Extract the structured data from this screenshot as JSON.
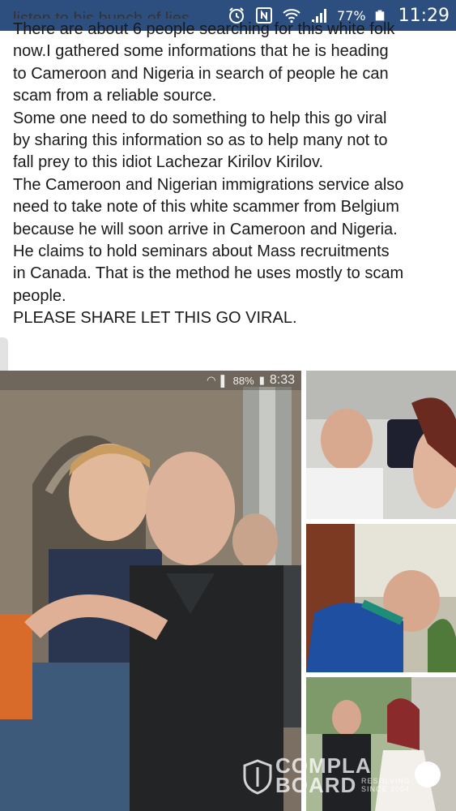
{
  "status_bar": {
    "battery": "77%",
    "time": "11:29",
    "icons": [
      "alarm-icon",
      "nfc-icon",
      "wifi-icon",
      "signal-icon",
      "battery-icon"
    ]
  },
  "post": {
    "cut_line": "listen to his bunch of lies.",
    "lines": [
      "There are about 6 people searching for this white folk",
      "now.I gathered some informations that he is heading",
      "to Cameroon and Nigeria in search of people he can",
      "scam from a reliable source.",
      "Some one need to do something to help this go viral",
      "by sharing this information so as to help many not to",
      "fall prey to this idiot Lachezar Kirilov Kirilov.",
      "The Cameroon and Nigerian immigrations service also",
      "need to take note of this white scammer from Belgium",
      "because he will soon arrive in Cameroon and Nigeria.",
      "He claims to hold seminars about Mass recruitments",
      "in Canada. That is the method he uses mostly to scam",
      "people.",
      "PLEASE SHARE LET THIS GO VIRAL."
    ]
  },
  "main_photo": {
    "inner_battery": "88%",
    "inner_time": "8:33"
  },
  "watermark": {
    "name": "COMPLAINTS BOARD",
    "line1": "COMPLA",
    "line2": "BOARD",
    "sub1": "RESOLVING",
    "sub2": "SINCE 2004"
  }
}
